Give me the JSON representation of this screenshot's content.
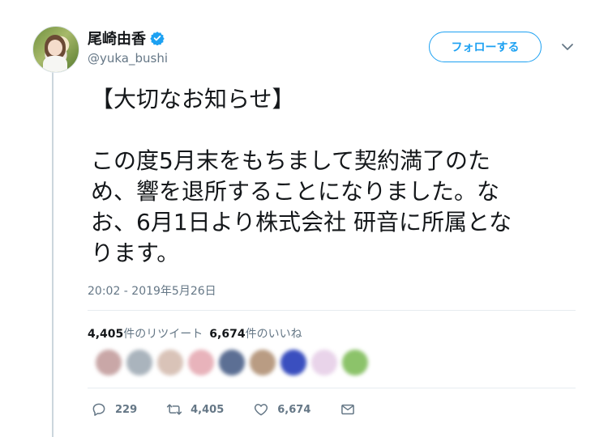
{
  "user": {
    "display_name": "尾崎由香",
    "handle": "@yuka_bushi",
    "verified": true
  },
  "follow_button_label": "フォローする",
  "tweet": {
    "lines": [
      "【大切なお知らせ】",
      "",
      "この度5月末をもちまして契約満了のた",
      "め、響を退所することになりました。な",
      "お、6月1日より株式会社 研音に所属とな",
      "ります。"
    ],
    "timestamp": "20:02 - 2019年5月26日"
  },
  "stats": {
    "retweets_count": "4,405",
    "retweets_label": "件のリツイート",
    "likes_count": "6,674",
    "likes_label": "件のいいね"
  },
  "likers": [
    "#c9a7a7",
    "#aab4bd",
    "#d9c3b8",
    "#e8b3bb",
    "#5c6f94",
    "#b99c83",
    "#3a4fbf",
    "#e9d4ea",
    "#8cc36a"
  ],
  "actions": {
    "reply_count": "229",
    "retweet_count": "4,405",
    "like_count": "6,674"
  },
  "colors": {
    "accent": "#1da1f2",
    "secondary_text": "#657786"
  }
}
